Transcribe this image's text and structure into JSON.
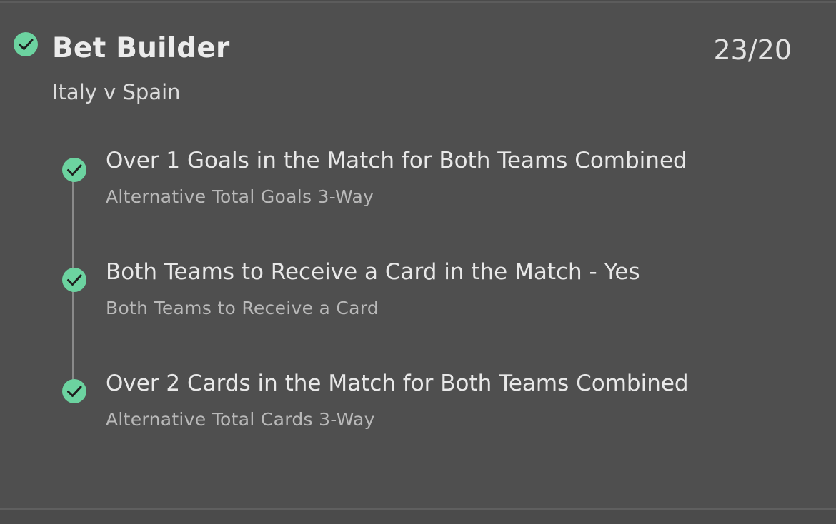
{
  "bet": {
    "title": "Bet Builder",
    "odds": "23/20",
    "event": "Italy v Spain",
    "status_icon": "check-circle-icon",
    "accent_color": "#6cd3a0"
  },
  "legs": [
    {
      "selection": "Over 1 Goals in the Match for Both Teams Combined",
      "market": "Alternative Total Goals 3-Way",
      "status_icon": "check-circle-icon"
    },
    {
      "selection": "Both Teams to Receive a Card in the Match - Yes",
      "market": "Both Teams to Receive a Card",
      "status_icon": "check-circle-icon"
    },
    {
      "selection": "Over 2 Cards in the Match for Both Teams Combined",
      "market": "Alternative Total Cards 3-Way",
      "status_icon": "check-circle-icon"
    }
  ]
}
